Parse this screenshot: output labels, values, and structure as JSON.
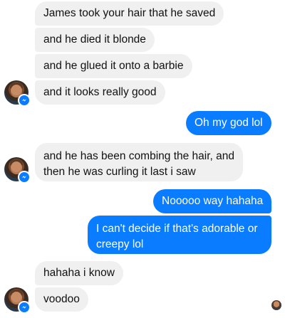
{
  "conversation": {
    "messages": [
      {
        "text": "James took your hair that he saved",
        "from": "them"
      },
      {
        "text": "and he died it blonde",
        "from": "them"
      },
      {
        "text": "and he glued it onto a barbie",
        "from": "them"
      },
      {
        "text": "and it looks really good",
        "from": "them"
      },
      {
        "text": "Oh my god lol",
        "from": "me"
      },
      {
        "text": "and he has been combing the hair, and then he was curling it last i saw",
        "from": "them"
      },
      {
        "text": "Nooooo way hahaha",
        "from": "me"
      },
      {
        "text": "I can't decide if that's adorable or creepy lol",
        "from": "me"
      },
      {
        "text": "hahaha i know",
        "from": "them"
      },
      {
        "text": "voodoo",
        "from": "them"
      }
    ]
  },
  "icons": {
    "contact_avatar": "person-photo-icon",
    "messenger_badge": "messenger-bolt-icon",
    "read_receipt": "read-receipt-avatar-icon"
  },
  "colors": {
    "incoming_bubble": "#f0f0f0",
    "outgoing_bubble": "#0a7cff",
    "badge": "#0a7cff"
  }
}
